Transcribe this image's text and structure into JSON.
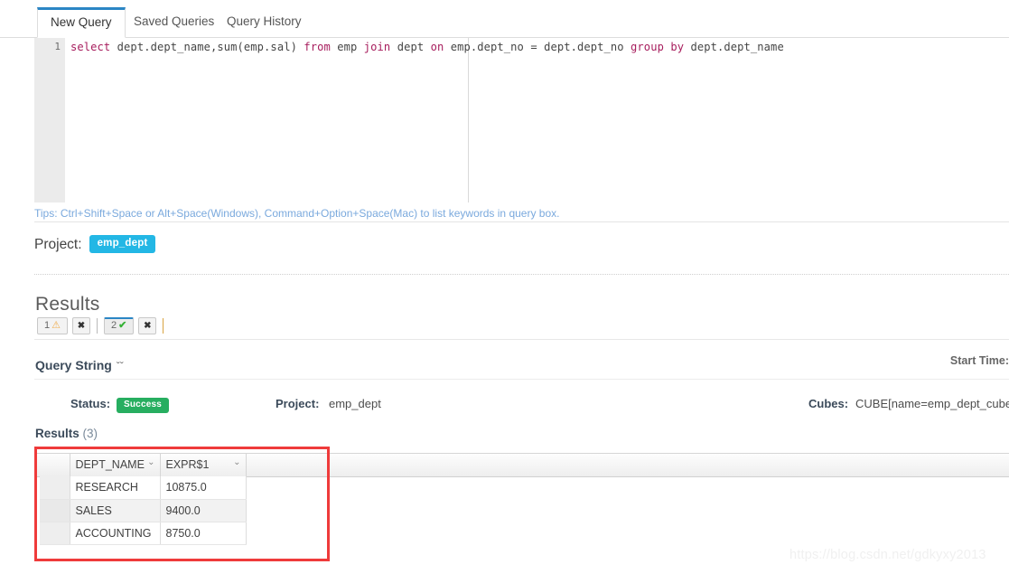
{
  "editor_tabs": [
    {
      "label": "New Query",
      "active": true
    },
    {
      "label": "Saved Queries",
      "active": false
    },
    {
      "label": "Query History",
      "active": false
    }
  ],
  "editor": {
    "line_number": "1",
    "sql_tokens": [
      {
        "t": "select ",
        "k": true
      },
      {
        "t": "dept.dept_name,sum(emp.sal) ",
        "k": false
      },
      {
        "t": "from ",
        "k": true
      },
      {
        "t": "emp ",
        "k": false
      },
      {
        "t": "join ",
        "k": true
      },
      {
        "t": "dept ",
        "k": false
      },
      {
        "t": "on ",
        "k": true
      },
      {
        "t": "emp.dept_no = dept.dept_no ",
        "k": false
      },
      {
        "t": "group by ",
        "k": true
      },
      {
        "t": "dept.dept_name",
        "k": false
      }
    ],
    "sql_plain": "select dept.dept_name,sum(emp.sal) from emp join dept on emp.dept_no = dept.dept_no group by dept.dept_name",
    "tips": "Tips: Ctrl+Shift+Space or Alt+Space(Windows), Command+Option+Space(Mac) to list keywords in query box."
  },
  "project_row": {
    "label": "Project:",
    "badge": "emp_dept"
  },
  "results": {
    "heading": "Results",
    "tabs": [
      {
        "number": "1",
        "icon": "warning-icon",
        "glyph": "⚠",
        "active": false,
        "close": "✖"
      },
      {
        "number": "2",
        "icon": "check-icon",
        "glyph": "✔",
        "active": true,
        "close": "✖"
      }
    ]
  },
  "query_string": {
    "label": "Query String",
    "chevron": "ˇˇ",
    "start_time_label": "Start Time:"
  },
  "status": {
    "status_label": "Status:",
    "status_value": "Success",
    "project_label": "Project:",
    "project_value": "emp_dept",
    "cubes_label": "Cubes:",
    "cubes_value": "CUBE[name=emp_dept_cube]"
  },
  "grid": {
    "results_label": "Results",
    "results_count": "(3)",
    "columns": [
      {
        "label": "",
        "chevron": ""
      },
      {
        "label": "DEPT_NAME",
        "chevron": "⌄"
      },
      {
        "label": "EXPR$1",
        "chevron": "⌄"
      }
    ],
    "rows": [
      {
        "idx": "",
        "cells": [
          "RESEARCH",
          "10875.0"
        ]
      },
      {
        "idx": "",
        "cells": [
          "SALES",
          "9400.0"
        ]
      },
      {
        "idx": "",
        "cells": [
          "ACCOUNTING",
          "8750.0"
        ]
      }
    ]
  },
  "watermark": "https://blog.csdn.net/gdkyxy2013",
  "colors": {
    "accent_blue": "#2b86c5",
    "badge_cyan": "#23b7e5",
    "success_green": "#27ae60",
    "warn_orange": "#f0ad4e",
    "highlight_red": "#ef3b3b",
    "tips_blue": "#7aa9dd",
    "keyword_purple": "#a71d5d"
  }
}
